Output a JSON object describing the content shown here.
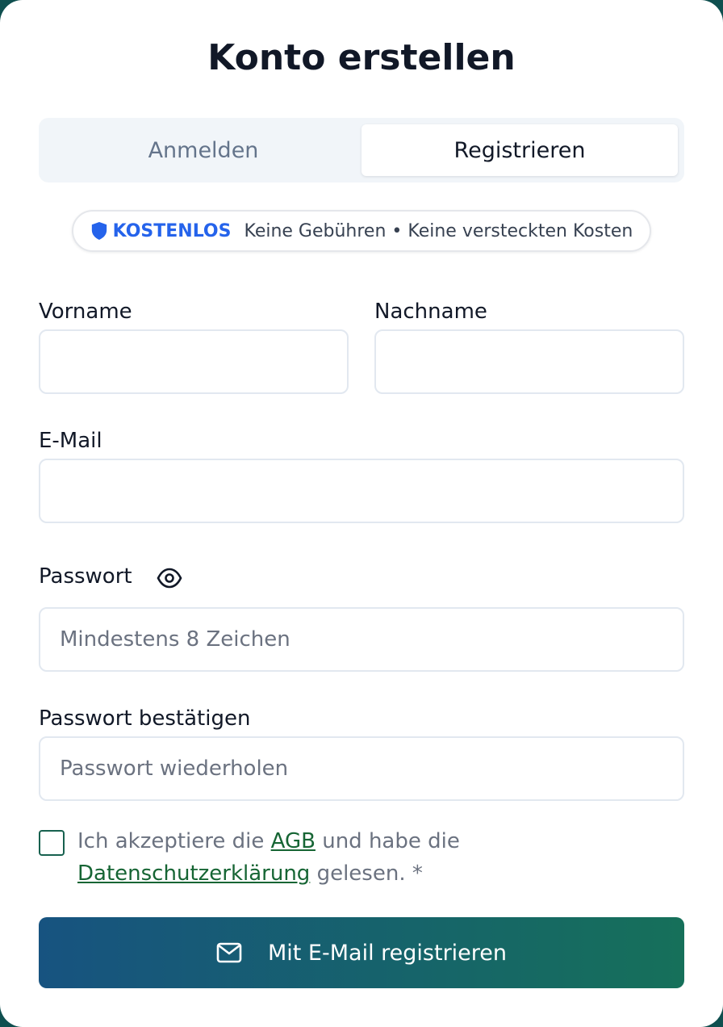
{
  "title": "Konto erstellen",
  "tabs": [
    {
      "label": "Anmelden",
      "active": false
    },
    {
      "label": "Registrieren",
      "active": true
    }
  ],
  "badge": {
    "icon": "shield-icon",
    "keyword": "KOSTENLOS",
    "text": "Keine Gebühren • Keine versteckten Kosten",
    "accent_color": "#2563eb"
  },
  "fields": {
    "first_name": {
      "label": "Vorname",
      "value": "",
      "placeholder": ""
    },
    "last_name": {
      "label": "Nachname",
      "value": "",
      "placeholder": ""
    },
    "email": {
      "label": "E-Mail",
      "value": "",
      "placeholder": ""
    },
    "password": {
      "label": "Passwort",
      "value": "",
      "placeholder": "Mindestens 8 Zeichen",
      "toggle_icon": "eye-icon"
    },
    "password_confirm": {
      "label": "Passwort bestätigen",
      "value": "",
      "placeholder": "Passwort wiederholen"
    }
  },
  "consent": {
    "checked": false,
    "prefix": "Ich akzeptiere die ",
    "terms_link": "AGB",
    "middle": " und habe die ",
    "privacy_link": "Datenschutzerklärung",
    "suffix": " gelesen. *"
  },
  "submit": {
    "label": "Mit E-Mail registrieren",
    "icon": "mail-icon",
    "gradient_start": "#175380",
    "gradient_end": "#16705a"
  }
}
